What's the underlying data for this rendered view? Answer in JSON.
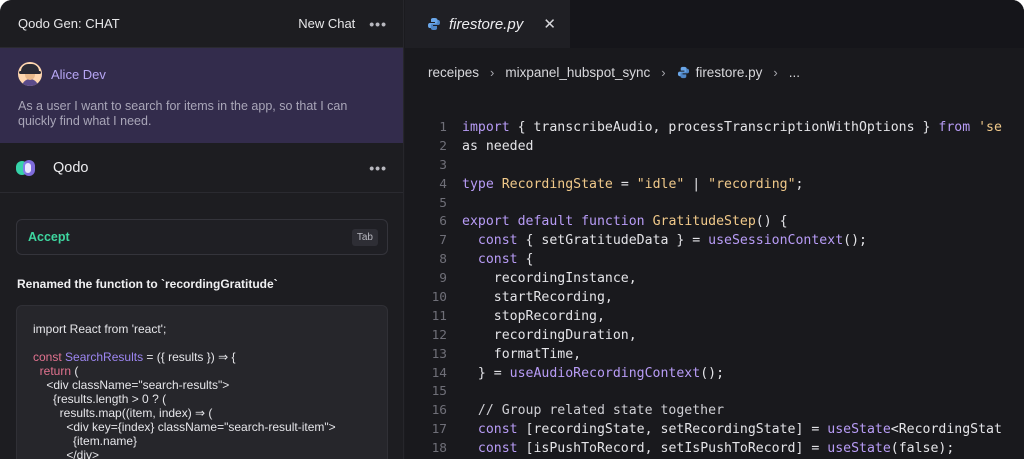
{
  "chat": {
    "header_title": "Qodo Gen: CHAT",
    "new_chat_label": "New Chat",
    "more_label": "•••",
    "user": {
      "name": "Alice Dev",
      "message": "As a user I want to search for items in the app, so that I can quickly find what I need."
    },
    "assistant": {
      "name": "Qodo",
      "more_label": "•••",
      "accept_label": "Accept",
      "accept_shortcut": "Tab",
      "summary": "Renamed the function to `recordingGratitude`"
    },
    "snippet_lines": [
      "import React from 'react';",
      "",
      "const SearchResults = ({ results }) ⇒ {",
      "  return (",
      "    <div className=\"search-results\">",
      "      {results.length > 0 ? (",
      "        results.map((item, index) ⇒ (",
      "          <div key={index} className=\"search-result-item\">",
      "            {item.name}",
      "          </div>"
    ]
  },
  "editor": {
    "tab": {
      "label": "firestore.py",
      "close_label": "✕"
    },
    "breadcrumb": [
      "receipes",
      "mixpanel_hubspot_sync",
      "firestore.py",
      "..."
    ],
    "breadcrumb_separator": "›",
    "line_numbers": [
      "1",
      "2",
      "3",
      "4",
      "5",
      "6",
      "7",
      "8",
      "9",
      "10",
      "11",
      "12",
      "13",
      "14",
      "15",
      "16",
      "17",
      "18"
    ],
    "code_lines": [
      "import { transcribeAudio, processTranscriptionWithOptions } from 'se",
      "as needed",
      "",
      "type RecordingState = \"idle\" | \"recording\";",
      "",
      "export default function GratitudeStep() {",
      "  const { setGratitudeData } = useSessionContext();",
      "  const {",
      "    recordingInstance,",
      "    startRecording,",
      "    stopRecording,",
      "    recordingDuration,",
      "    formatTime,",
      "  } = useAudioRecordingContext();",
      "",
      "  // Group related state together",
      "  const [recordingState, setRecordingState] = useState<RecordingStat",
      "  const [isPushToRecord, setIsPushToRecord] = useState(false);"
    ]
  },
  "colors": {
    "user_bg": "#332c4c",
    "accept_green": "#3ed59f",
    "keyword": "#b89cf6",
    "string": "#f0c98a"
  },
  "icons": {
    "python": "python-icon",
    "avatar": "user-avatar",
    "qodo": "qodo-logo-icon"
  }
}
